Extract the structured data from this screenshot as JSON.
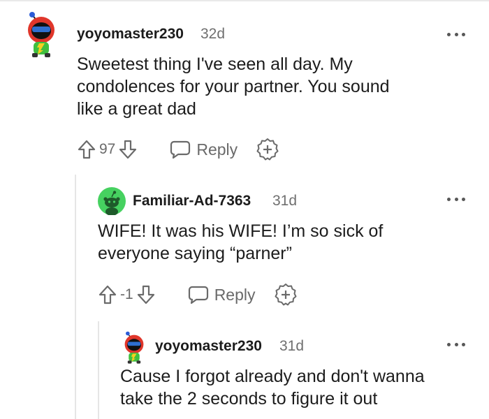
{
  "comments": [
    {
      "username": "yoyomaster230",
      "time": "32d",
      "text": "Sweetest thing I've seen all day. My condolences for your partner. You sound like a great dad",
      "score": "97",
      "reply_label": "Reply",
      "avatar": "snoo-avatar-red-helmet"
    },
    {
      "username": "Familiar-Ad-7363",
      "time": "31d",
      "text": "WIFE! It was his WIFE! I’m so sick of everyone saying “parner”",
      "score": "-1",
      "reply_label": "Reply",
      "avatar": "snoo-avatar-green-default"
    },
    {
      "username": "yoyomaster230",
      "time": "31d",
      "text": "Cause I forgot already and don't wanna take the 2 seconds to figure it out",
      "avatar": "snoo-avatar-red-helmet"
    }
  ],
  "icons": {
    "upvote": "upvote-arrow-icon",
    "downvote": "downvote-arrow-icon",
    "reply": "speech-bubble-icon",
    "award": "award-plus-icon",
    "more": "more-options-icon"
  },
  "colors": {
    "text": "#1c1c1c",
    "meta": "#6f6f6f",
    "icon": "#6a6a6a",
    "avatar_green": "#46d160",
    "avatar_red": "#e0362b"
  }
}
